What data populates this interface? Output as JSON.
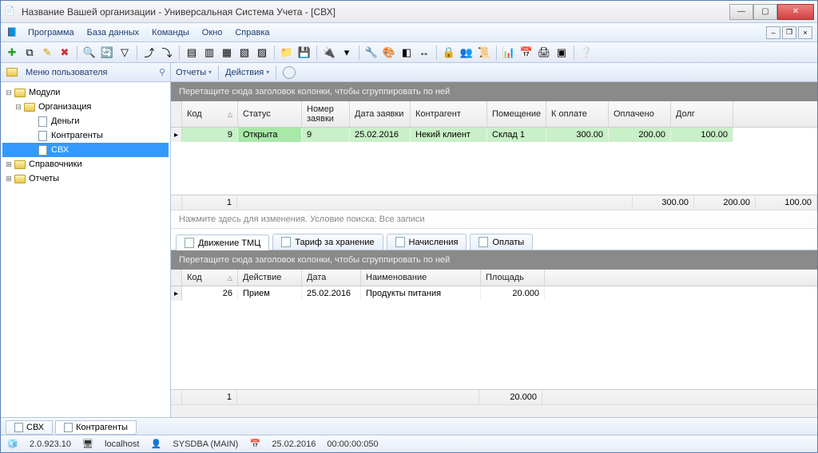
{
  "window": {
    "title": "Название Вашей организации - Универсальная Система Учета - [СВХ]"
  },
  "menubar": {
    "items": [
      "Программа",
      "База данных",
      "Команды",
      "Окно",
      "Справка"
    ]
  },
  "sidebar": {
    "title": "Меню пользователя",
    "tree": {
      "root": "Модули",
      "org": "Организация",
      "money": "Деньги",
      "contr": "Контрагенты",
      "svh": "СВХ",
      "ref": "Справочники",
      "rep": "Отчеты"
    }
  },
  "subtoolbar": {
    "reports": "Отчеты",
    "actions": "Действия"
  },
  "top_grid": {
    "group_hint": "Перетащите сюда заголовок колонки, чтобы сгруппировать по ней",
    "cols": {
      "code": "Код",
      "status": "Статус",
      "num": "Номер заявки",
      "date": "Дата заявки",
      "contr": "Контрагент",
      "room": "Помещение",
      "pay": "К оплате",
      "paid": "Оплачено",
      "debt": "Долг"
    },
    "row": {
      "code": "9",
      "status": "Открыта",
      "num": "9",
      "date": "25.02.2016",
      "contr": "Некий клиент",
      "room": "Склад 1",
      "pay": "300.00",
      "paid": "200.00",
      "debt": "100.00"
    },
    "sum": {
      "count": "1",
      "pay": "300.00",
      "paid": "200.00",
      "debt": "100.00"
    }
  },
  "search_hint": "Нажмите здесь для изменения. Условие поиска: Все записи",
  "detail_tabs": {
    "t0": "Движение ТМЦ",
    "t1": "Тариф за хранение",
    "t2": "Начисления",
    "t3": "Оплаты"
  },
  "bottom_grid": {
    "group_hint": "Перетащите сюда заголовок колонки, чтобы сгруппировать по ней",
    "cols": {
      "code": "Код",
      "action": "Действие",
      "date": "Дата",
      "name": "Наименование",
      "area": "Площадь"
    },
    "row": {
      "code": "26",
      "action": "Прием",
      "date": "25.02.2016",
      "name": "Продукты питания",
      "area": "20.000"
    },
    "sum": {
      "count": "1",
      "area": "20.000"
    }
  },
  "footer_tabs": {
    "t0": "СВХ",
    "t1": "Контрагенты"
  },
  "status": {
    "ver": "2.0.923.10",
    "host": "localhost",
    "user": "SYSDBA (MAIN)",
    "date": "25.02.2016",
    "time": "00:00:00:050"
  }
}
